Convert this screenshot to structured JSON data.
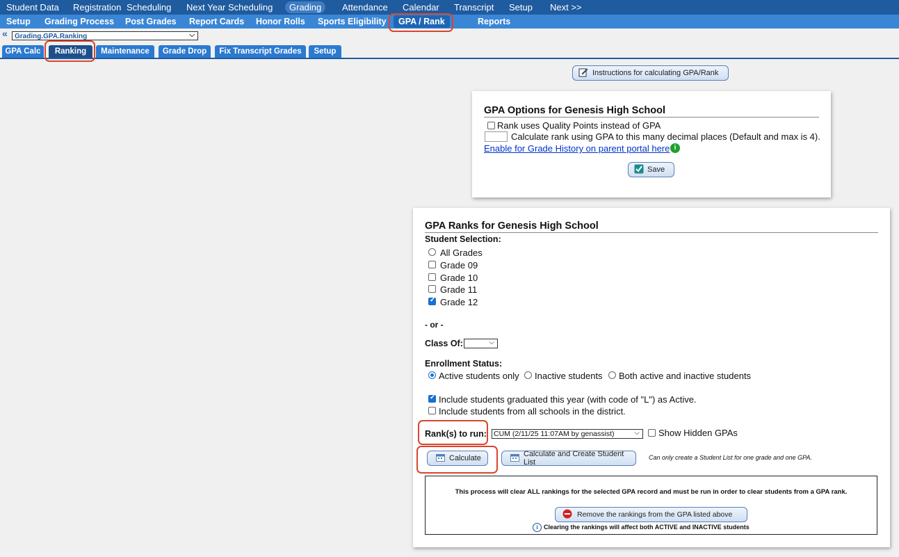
{
  "top_nav": [
    "Student Data",
    "Registration",
    "Scheduling",
    "Next Year Scheduling",
    "Grading",
    "Attendance",
    "Calendar",
    "Transcript",
    "Setup",
    "Next >>"
  ],
  "sub_nav": [
    "Setup",
    "Grading Process",
    "Post Grades",
    "Report Cards",
    "Honor Rolls",
    "Sports Eligibility",
    "GPA / Rank",
    "Reports"
  ],
  "breadcrumb": {
    "arrow": "«",
    "select_value": "Grading.GPA.Ranking"
  },
  "tabs": [
    "GPA Calc",
    "Ranking",
    "Maintenance",
    "Grade Drop",
    "Fix Transcript Grades",
    "Setup"
  ],
  "instructions_button": "Instructions for calculating GPA/Rank",
  "gpa_options": {
    "title": "GPA Options for Genesis High School",
    "rank_quality_points": "Rank uses Quality Points instead of GPA",
    "decimal_places_label": "Calculate rank using GPA to this many decimal places (Default and max is 4).",
    "grade_history_link": "Enable for Grade History on parent portal here",
    "save_button": "Save"
  },
  "gpa_ranks": {
    "title": "GPA Ranks for Genesis High School",
    "student_selection_label": "Student Selection:",
    "all_grades": "All Grades",
    "grades": [
      "Grade 09",
      "Grade 10",
      "Grade 11",
      "Grade 12"
    ],
    "or_label": "- or -",
    "class_of_label": "Class Of:",
    "enrollment_status_label": "Enrollment Status:",
    "enrollment_options": [
      "Active students only",
      "Inactive students",
      "Both active and inactive students"
    ],
    "include_graduated": "Include students graduated this year (with code of \"L\") as Active.",
    "include_all_schools": "Include students from all schools in the district.",
    "ranks_to_run_label": "Rank(s) to run:",
    "ranks_to_run_value": "CUM (2/11/25 11:07AM by genassist)",
    "show_hidden": "Show Hidden GPAs",
    "calculate_button": "Calculate",
    "calculate_list_button": "Calculate and Create Student List",
    "calc_note": "Can only create a Student List for one grade and one GPA.",
    "clear_warning": "This process will clear ALL rankings for the selected GPA record and must be run in order to clear students from a GPA rank.",
    "remove_button": "Remove the rankings from the GPA listed above",
    "clear_note": "Clearing the rankings will affect both ACTIVE and INACTIVE students"
  }
}
